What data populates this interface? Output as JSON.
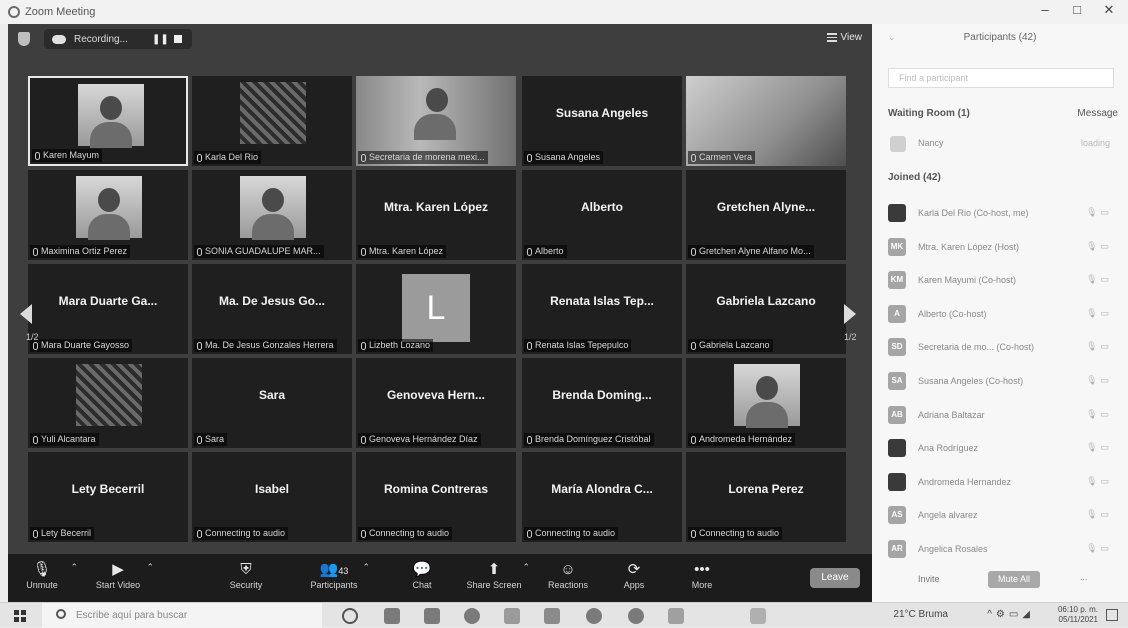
{
  "window": {
    "title": "Zoom Meeting",
    "minimize": "–",
    "maximize": "□",
    "close": "✕"
  },
  "topbar": {
    "recording_label": "Recording...",
    "pause": "❚❚",
    "view_label": "View"
  },
  "tiles": [
    {
      "display": "",
      "label": "Karen Mayum",
      "kind": "photo",
      "active": true
    },
    {
      "display": "",
      "label": "Karla Del Rio",
      "kind": "pattern"
    },
    {
      "display": "",
      "label": "Secretaria de morena mexi...",
      "kind": "scene"
    },
    {
      "display": "Susana Angeles",
      "label": "Susana Angeles",
      "kind": "name"
    },
    {
      "display": "",
      "label": "Carmen Vera",
      "kind": "office"
    },
    {
      "display": "",
      "label": "Maximina Ortiz Perez",
      "kind": "photo"
    },
    {
      "display": "",
      "label": "SONIA GUADALUPE MAR...",
      "kind": "photo"
    },
    {
      "display": "Mtra. Karen López",
      "label": "Mtra. Karen López",
      "kind": "name"
    },
    {
      "display": "Alberto",
      "label": "Alberto",
      "kind": "name"
    },
    {
      "display": "Gretchen Alyne...",
      "label": "Gretchen Alyne Alfano Mo...",
      "kind": "name"
    },
    {
      "display": "Mara Duarte Ga...",
      "label": "Mara Duarte Gayosso",
      "kind": "name"
    },
    {
      "display": "Ma. De Jesus Go...",
      "label": "Ma. De Jesus Gonzales Herrera",
      "kind": "name"
    },
    {
      "display": "L",
      "label": "Lizbeth Lozano",
      "kind": "letter"
    },
    {
      "display": "Renata Islas Tep...",
      "label": "Renata Islas Tepepulco",
      "kind": "name"
    },
    {
      "display": "Gabriela Lazcano",
      "label": "Gabriela Lazcano",
      "kind": "name"
    },
    {
      "display": "",
      "label": "Yuli Alcantara",
      "kind": "pattern"
    },
    {
      "display": "Sara",
      "label": "Sara",
      "kind": "name"
    },
    {
      "display": "Genoveva Hern...",
      "label": "Genoveva Hernández Díaz",
      "kind": "name"
    },
    {
      "display": "Brenda Doming...",
      "label": "Brenda Domínguez Cristóbal",
      "kind": "name"
    },
    {
      "display": "",
      "label": "Andromeda Hernández",
      "kind": "photo"
    },
    {
      "display": "Lety Becerril",
      "label": "Lety Becerril",
      "kind": "name"
    },
    {
      "display": "Isabel",
      "label": "Connecting to audio",
      "kind": "name"
    },
    {
      "display": "Romina Contreras",
      "label": "Connecting to audio",
      "kind": "name"
    },
    {
      "display": "María Alondra C...",
      "label": "Connecting to audio",
      "kind": "name"
    },
    {
      "display": "Lorena Perez",
      "label": "Connecting to audio",
      "kind": "name"
    }
  ],
  "pager": {
    "left": "1/2",
    "right": "1/2"
  },
  "toolbar": {
    "unmute": "Unmute",
    "start_video": "Start Video",
    "security": "Security",
    "participants": "Participants",
    "participants_count": "43",
    "chat": "Chat",
    "share_screen": "Share Screen",
    "reactions": "Reactions",
    "apps": "Apps",
    "more": "More",
    "leave": "Leave"
  },
  "panel": {
    "title": "Participants (42)",
    "search_placeholder": "Find a participant",
    "waiting_room": "Waiting Room (1)",
    "message": "Message",
    "waiting_name": "Nancy",
    "waiting_status": "loading",
    "joined": "Joined (42)",
    "people": [
      {
        "initials": "",
        "name": "Karla Del Rio (Co-host, me)"
      },
      {
        "initials": "MK",
        "name": "Mtra. Karen López (Host)"
      },
      {
        "initials": "KM",
        "name": "Karen Mayumi (Co-host)"
      },
      {
        "initials": "A",
        "name": "Alberto (Co-host)"
      },
      {
        "initials": "SD",
        "name": "Secretaria de mo... (Co-host)"
      },
      {
        "initials": "SA",
        "name": "Susana Angeles (Co-host)"
      },
      {
        "initials": "AB",
        "name": "Adriana Baltazar"
      },
      {
        "initials": "",
        "name": "Ana Rodríguez"
      },
      {
        "initials": "",
        "name": "Andromeda Hernandez"
      },
      {
        "initials": "AS",
        "name": "Angela alvarez"
      },
      {
        "initials": "AR",
        "name": "Angelica Rosales"
      }
    ],
    "invite": "Invite",
    "mute_all": "Mute All",
    "more": "..."
  },
  "taskbar": {
    "search_placeholder": "Escribe aquí para buscar",
    "weather": "21°C Bruma",
    "time": "06:10 p. m.",
    "date": "05/11/2021"
  }
}
